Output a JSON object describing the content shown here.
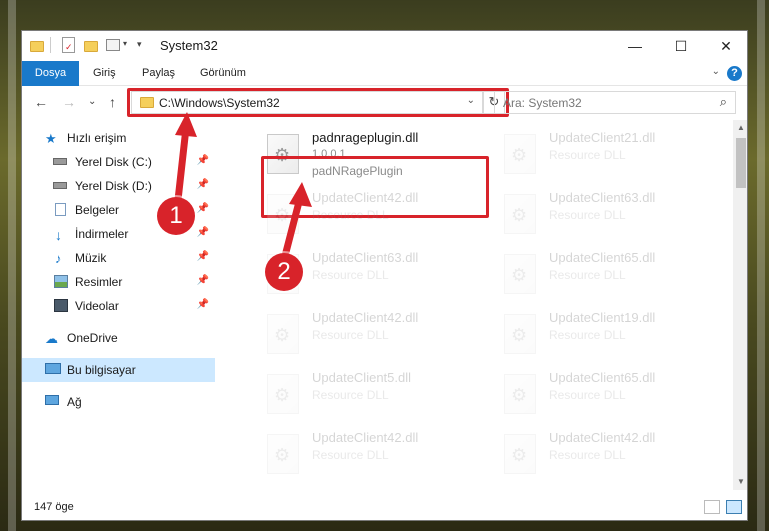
{
  "window": {
    "title": "System32",
    "controls": [
      "—",
      "☐",
      "✕"
    ]
  },
  "ribbon": {
    "tabs": [
      "Dosya",
      "Giriş",
      "Paylaş",
      "Görünüm"
    ],
    "help": "?",
    "collapse": "⌄"
  },
  "navigation": {
    "back": "←",
    "forward": "→",
    "recent": "⌄",
    "up": "↑",
    "address": "C:\\Windows\\System32",
    "address_dropdown": "⌄",
    "refresh": "↻",
    "search_placeholder": "Ara: System32",
    "search_icon": "⌕"
  },
  "sidebar": {
    "items": [
      {
        "label": "Hızlı erişim",
        "icon": "star-icon",
        "pinned": false
      },
      {
        "label": "Yerel Disk (C:)",
        "icon": "drive-icon",
        "pinned": true
      },
      {
        "label": "Yerel Disk (D:)",
        "icon": "drive-icon",
        "pinned": true
      },
      {
        "label": "Belgeler",
        "icon": "documents-icon",
        "pinned": true
      },
      {
        "label": "İndirmeler",
        "icon": "download-icon",
        "pinned": true
      },
      {
        "label": "Müzik",
        "icon": "music-icon",
        "pinned": true
      },
      {
        "label": "Resimler",
        "icon": "pictures-icon",
        "pinned": true
      },
      {
        "label": "Videolar",
        "icon": "videos-icon",
        "pinned": true
      },
      {
        "label": "OneDrive",
        "icon": "cloud-icon",
        "pinned": false
      },
      {
        "label": "Bu bilgisayar",
        "icon": "computer-icon",
        "pinned": false
      },
      {
        "label": "Ağ",
        "icon": "network-icon",
        "pinned": false
      }
    ],
    "pin_glyph": "📌"
  },
  "files": [
    {
      "name": "padnrageplugin.dll",
      "version": "1.0.0.1",
      "description": "padNRagePlugin"
    },
    {
      "name": "UpdateClient21.dll",
      "version": "",
      "description": "Resource DLL"
    },
    {
      "name": "UpdateClient42.dll",
      "version": "",
      "description": "Resource DLL"
    },
    {
      "name": "UpdateClient63.dll",
      "version": "",
      "description": "Resource DLL"
    },
    {
      "name": "UpdateClient63.dll",
      "version": "",
      "description": "Resource DLL"
    },
    {
      "name": "UpdateClient65.dll",
      "version": "",
      "description": "Resource DLL"
    },
    {
      "name": "UpdateClient42.dll",
      "version": "",
      "description": "Resource DLL"
    },
    {
      "name": "UpdateClient19.dll",
      "version": "",
      "description": "Resource DLL"
    },
    {
      "name": "UpdateClient5.dll",
      "version": "",
      "description": "Resource DLL"
    },
    {
      "name": "UpdateClient65.dll",
      "version": "",
      "description": "Resource DLL"
    },
    {
      "name": "UpdateClient42.dll",
      "version": "",
      "description": "Resource DLL"
    },
    {
      "name": "UpdateClient42.dll",
      "version": "",
      "description": "Resource DLL"
    }
  ],
  "status": {
    "count": "147 öge"
  },
  "annotations": {
    "step1": "1",
    "step2": "2"
  },
  "colors": {
    "accent": "#1979ca",
    "highlight": "#d8232a",
    "selection": "#cce8ff"
  }
}
